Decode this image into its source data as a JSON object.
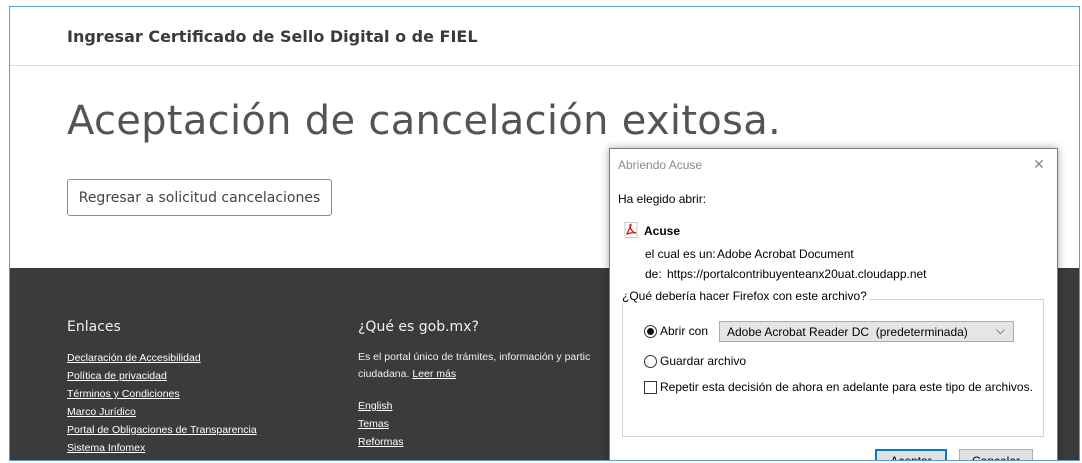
{
  "page": {
    "cert_title": "Ingresar Certificado de Sello Digital o de FIEL",
    "heading": "Aceptación de cancelación exitosa.",
    "back_button": "Regresar a solicitud cancelaciones"
  },
  "footer": {
    "links_title": "Enlaces",
    "links": [
      "Declaración de Accesibilidad",
      "Política de privacidad",
      "Términos y Condiciones",
      "Marco Jurídico",
      "Portal de Obligaciones de Transparencia",
      "Sistema Infomex"
    ],
    "about_title": "¿Qué es gob.mx?",
    "about_text_1": "Es el portal único de trámites, información y partic",
    "about_text_2": "ciudadana.",
    "about_more": "Leer más",
    "about_links": [
      "English",
      "Temas",
      "Reformas"
    ]
  },
  "dialog": {
    "title": "Abriendo Acuse",
    "chosen_label": "Ha elegido abrir:",
    "file_name": "Acuse",
    "type_label": "el cual es un:",
    "type_value": "Adobe Acrobat Document",
    "from_label": "de:",
    "from_value": "https://portalcontribuyenteanx20uat.cloudapp.net",
    "question": "¿Qué debería hacer Firefox con este archivo?",
    "open_with": "Abrir con",
    "open_app": "Adobe Acrobat Reader DC  (predeterminada)",
    "save_file": "Guardar archivo",
    "remember": "Repetir esta decisión de ahora en adelante para este tipo de archivos.",
    "accept": "Aceptar",
    "cancel": "Cancelar",
    "icons": {
      "close": "close-icon",
      "file": "pdf-icon",
      "dropdown": "chevron-down-icon"
    }
  }
}
